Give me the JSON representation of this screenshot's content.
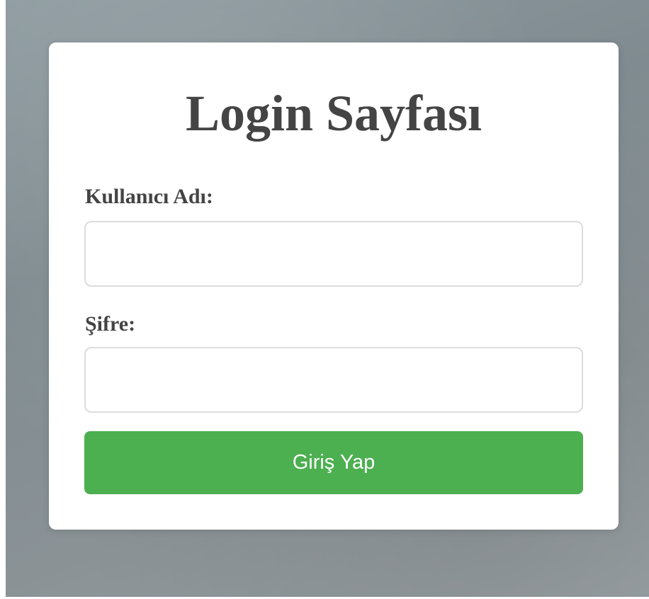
{
  "login": {
    "title": "Login Sayfası",
    "username_label": "Kullanıcı Adı:",
    "username_value": "",
    "password_label": "Şifre:",
    "password_value": "",
    "submit_label": "Giriş Yap"
  },
  "colors": {
    "background": "#8a9599",
    "card": "#ffffff",
    "text": "#444444",
    "input_border": "#dcdcdc",
    "button": "#4caf50",
    "button_text": "#ffffff"
  }
}
